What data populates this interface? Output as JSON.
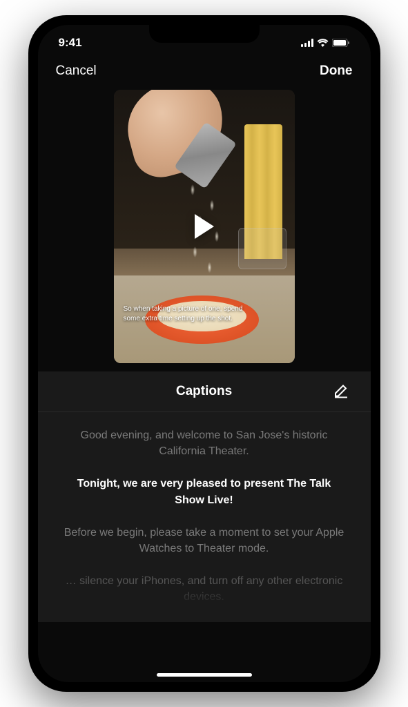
{
  "status": {
    "time": "9:41"
  },
  "nav": {
    "cancel": "Cancel",
    "done": "Done"
  },
  "video": {
    "overlay_caption": "So when taking a picture of one, spend some extra time setting up the shot."
  },
  "captions": {
    "title": "Captions",
    "items": [
      {
        "text": "Good evening, and welcome to San Jose's historic California Theater.",
        "state": "inactive"
      },
      {
        "text": "Tonight, we are very pleased to present The Talk Show Live!",
        "state": "active"
      },
      {
        "text": "Before we begin, please take a moment to set your Apple Watches to Theater mode.",
        "state": "inactive"
      },
      {
        "text": "… silence your iPhones, and turn off any other electronic devices.",
        "state": "faded"
      }
    ]
  }
}
